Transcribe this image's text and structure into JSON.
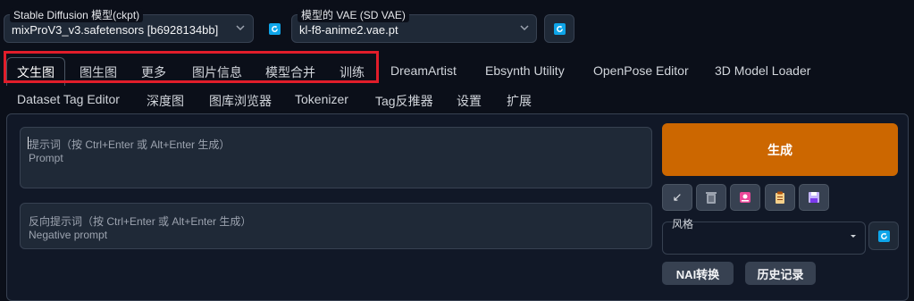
{
  "model_select": {
    "label": "Stable Diffusion 模型(ckpt)",
    "value": "mixProV3_v3.safetensors [b6928134bb]"
  },
  "vae_select": {
    "label": "模型的 VAE (SD VAE)",
    "value": "kl-f8-anime2.vae.pt"
  },
  "tabs_row1": [
    "文生图",
    "图生图",
    "更多",
    "图片信息",
    "模型合并",
    "训练",
    "DreamArtist",
    "Ebsynth Utility",
    "OpenPose Editor",
    "3D Model Loader"
  ],
  "tabs_row2": [
    "Dataset Tag Editor",
    "深度图",
    "图库浏览器",
    "Tokenizer",
    "Tag反推器",
    "设置",
    "扩展"
  ],
  "prompt": {
    "placeholder_line1": "提示词（按 Ctrl+Enter 或 Alt+Enter 生成）",
    "placeholder_line2": "Prompt"
  },
  "negative_prompt": {
    "placeholder_line1": "反向提示词（按 Ctrl+Enter 或 Alt+Enter 生成）",
    "placeholder_line2": "Negative prompt"
  },
  "generate_label": "生成",
  "tools": {
    "arrow": "↙"
  },
  "style": {
    "label": "风格"
  },
  "nai_label": "NAI转换",
  "history_label": "历史记录",
  "colors": {
    "accent": "#cc6700",
    "highlight": "#e11d2a",
    "refresh": "#0ea5e9"
  }
}
